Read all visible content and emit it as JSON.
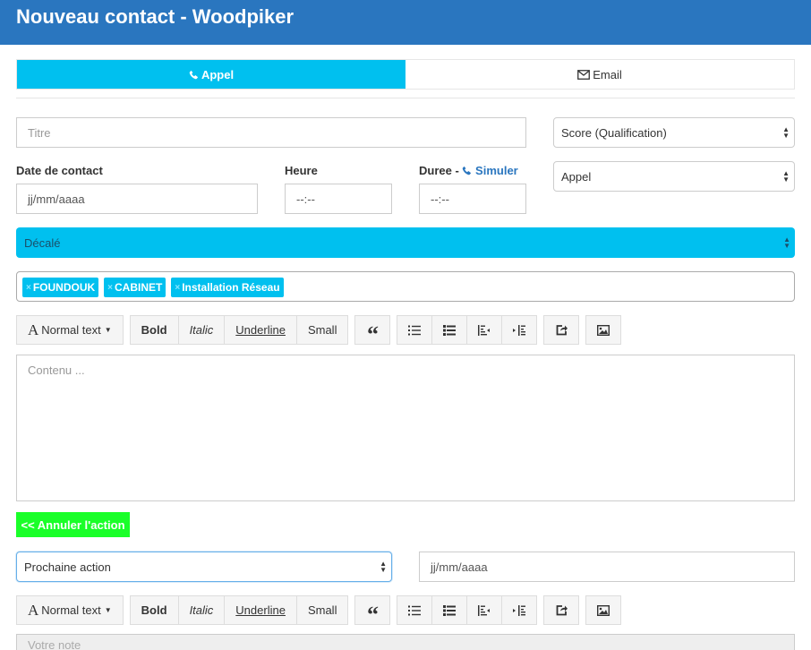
{
  "header": {
    "title": "Nouveau contact - Woodpiker"
  },
  "tabs": [
    {
      "label": "Appel",
      "icon": "phone-icon",
      "active": true
    },
    {
      "label": "Email",
      "icon": "envelope-icon",
      "active": false
    }
  ],
  "form": {
    "title_placeholder": "Titre",
    "score_select": "Score (Qualification)",
    "date_label": "Date de contact",
    "date_value": "jj/mm/aaaa",
    "time_label": "Heure",
    "time_value": "--:--",
    "duration_label": "Duree -",
    "simulate_link": "Simuler",
    "duration_value": "--:--",
    "type_select": "Appel",
    "status_select": "Décalé",
    "tags": [
      "FOUNDOUK",
      "CABINET",
      "Installation Réseau"
    ],
    "content_placeholder": "Contenu ...",
    "cancel_button": "<< Annuler l'action",
    "next_action_select": "Prochaine action",
    "next_action_date": "jj/mm/aaaa",
    "note_placeholder": "Votre note"
  },
  "toolbar": {
    "text_style": "Normal text",
    "bold": "Bold",
    "italic": "Italic",
    "underline": "Underline",
    "small": "Small",
    "quote": "“"
  },
  "colors": {
    "header": "#2a76bf",
    "accent": "#00c0ef",
    "cancel": "#1aff29"
  }
}
